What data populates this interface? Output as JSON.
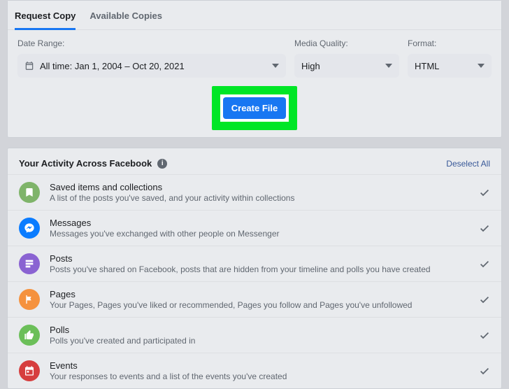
{
  "tabs": {
    "request": "Request Copy",
    "available": "Available Copies"
  },
  "fields": {
    "date_label": "Date Range:",
    "date_value": "All time: Jan 1, 2004 – Oct 20, 2021",
    "mq_label": "Media Quality:",
    "mq_value": "High",
    "fmt_label": "Format:",
    "fmt_value": "HTML"
  },
  "create_button": "Create File",
  "activity": {
    "heading": "Your Activity Across Facebook",
    "deselect": "Deselect All",
    "items": [
      {
        "title": "Saved items and collections",
        "desc": "A list of the posts you've saved, and your activity within collections"
      },
      {
        "title": "Messages",
        "desc": "Messages you've exchanged with other people on Messenger"
      },
      {
        "title": "Posts",
        "desc": "Posts you've shared on Facebook, posts that are hidden from your timeline and polls you have created"
      },
      {
        "title": "Pages",
        "desc": "Your Pages, Pages you've liked or recommended, Pages you follow and Pages you've unfollowed"
      },
      {
        "title": "Polls",
        "desc": "Polls you've created and participated in"
      },
      {
        "title": "Events",
        "desc": "Your responses to events and a list of the events you've created"
      }
    ]
  }
}
